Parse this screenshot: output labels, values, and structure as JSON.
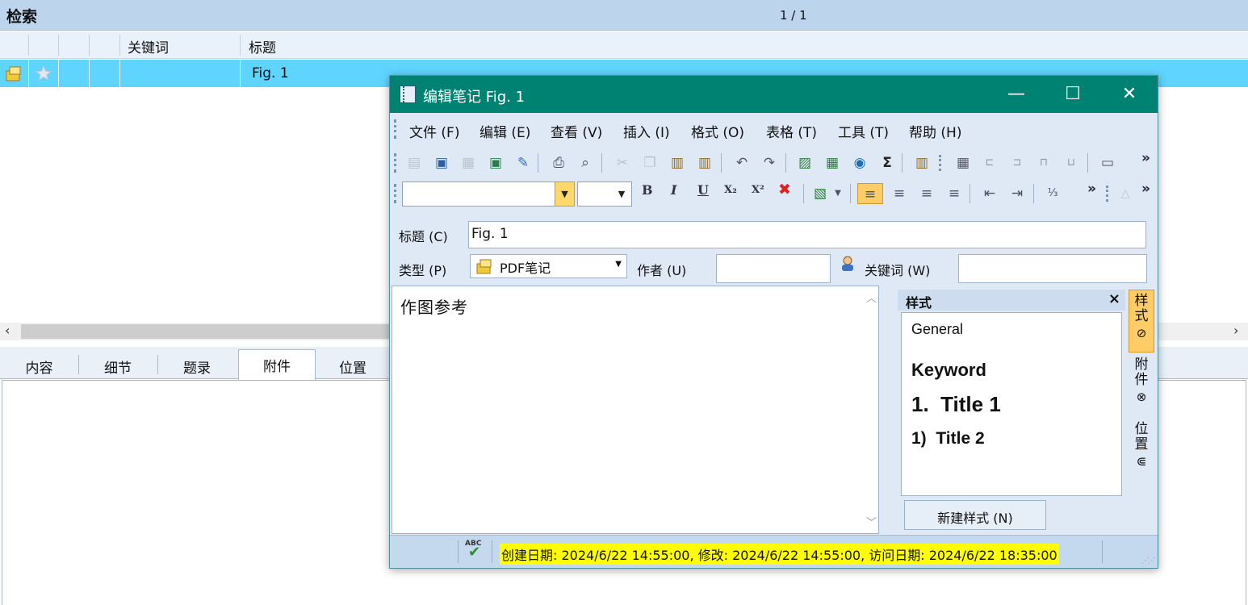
{
  "main": {
    "title": "检索",
    "pager": "1 / 1",
    "columns": [
      "关键词",
      "标题"
    ],
    "rows": [
      {
        "title": "Fig. 1"
      }
    ],
    "tabs": [
      "内容",
      "细节",
      "题录",
      "附件",
      "位置"
    ],
    "active_tab": "附件"
  },
  "dialog": {
    "title": "编辑笔记 Fig. 1",
    "window_buttons": {
      "minimize": "—",
      "maximize": "☐",
      "close": "✕"
    },
    "menu": [
      "文件 (F)",
      "编辑 (E)",
      "查看 (V)",
      "插入 (I)",
      "格式 (O)",
      "表格 (T)",
      "工具 (T)",
      "帮助 (H)"
    ],
    "format_bar": {
      "bold": "B",
      "italic": "I",
      "underline": "U",
      "subscript": "X₂",
      "superscript": "X²",
      "clear": "✖"
    },
    "form": {
      "title_label": "标题 (C)",
      "title_value": "Fig. 1",
      "type_label": "类型 (P)",
      "type_value": "PDF笔记",
      "author_label": "作者 (U)",
      "author_value": "",
      "keywords_label": "关键词 (W)",
      "keywords_value": ""
    },
    "editor_text": "作图参考",
    "styles_panel": {
      "header": "样式",
      "close": "×",
      "items": [
        "General",
        "Keyword",
        "1.  Title 1",
        "1)  Title 2"
      ],
      "new_button": "新建样式 (N)"
    },
    "side_tabs": [
      "样式",
      "附件",
      "位置"
    ],
    "status": {
      "spell_label": "ABC",
      "text": "创建日期: 2024/6/22 14:55:00, 修改: 2024/6/22 14:55:00, 访问日期: 2024/6/22 18:35:00"
    }
  },
  "colors": {
    "title_bar": "#008272",
    "selected_row": "#5fd4ff",
    "accent_gold": "#ffcc66",
    "status_highlight": "#ffff00"
  }
}
